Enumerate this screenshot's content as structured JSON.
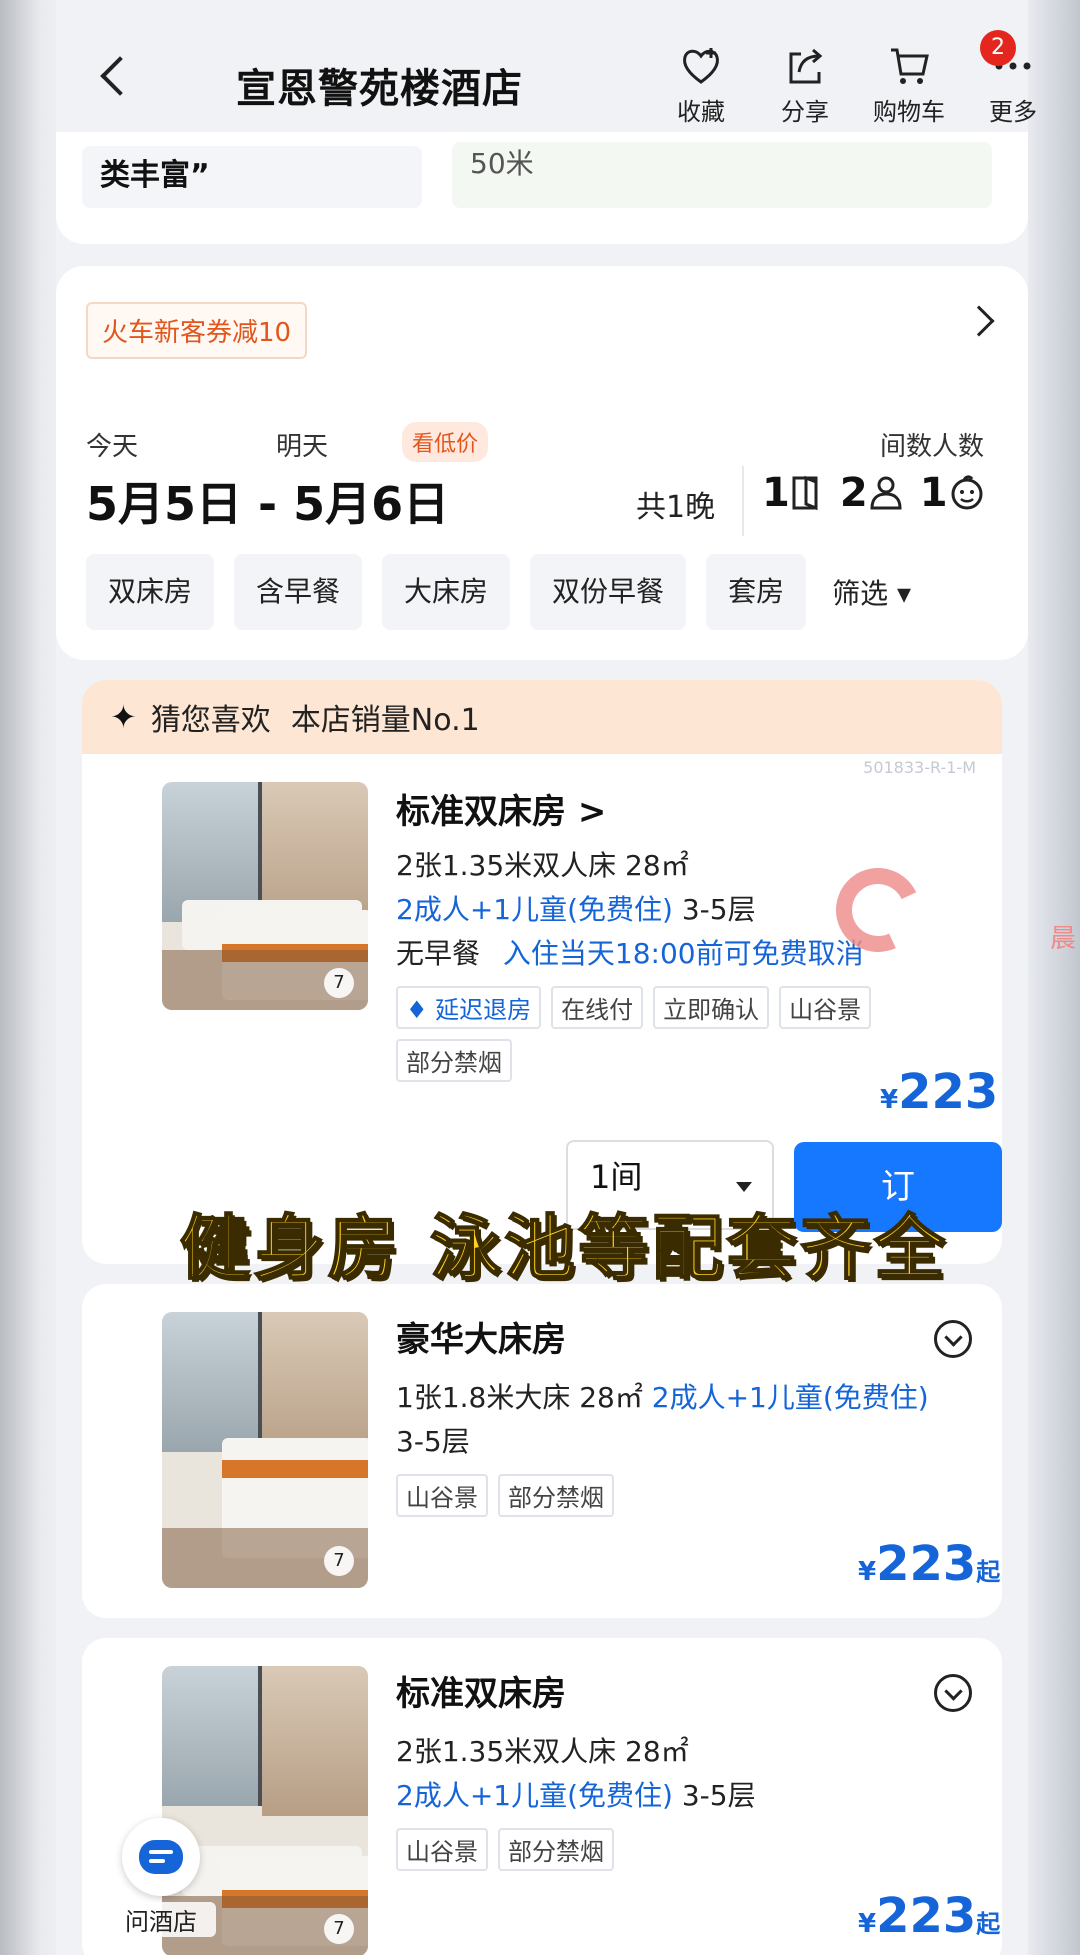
{
  "header": {
    "title": "宣恩警苑楼酒店",
    "actions": [
      {
        "label": "收藏",
        "icon": "heart-plus-icon"
      },
      {
        "label": "分享",
        "icon": "share-icon"
      },
      {
        "label": "购物车",
        "icon": "cart-icon"
      },
      {
        "label": "更多",
        "icon": "more-icon"
      }
    ],
    "more_badge": "2"
  },
  "top_fragment": {
    "left": "类丰富”",
    "right": "50米"
  },
  "coupon": "火车新客券减10",
  "booking": {
    "checkin_label": "今天",
    "checkout_label": "明天",
    "low_price": "看低价",
    "dates": "5月5日 - 5月6日",
    "nights": "共1晚",
    "guest_label": "间数人数",
    "rooms": "1",
    "adults": "2",
    "children": "1"
  },
  "filters": [
    "双床房",
    "含早餐",
    "大床房",
    "双份早餐",
    "套房"
  ],
  "filter_button": "筛选",
  "recommend": {
    "label": "猜您喜欢",
    "sub": "本店销量No.1",
    "code": "501833-R-1-M"
  },
  "rooms": [
    {
      "name": "标准双床房 >",
      "line1": "2张1.35米双人床  28㎡",
      "occupancy": "2成人+1儿童(免费住)",
      "floors": "3-5层",
      "breakfast": "无早餐",
      "cancel": "入住当天18:00前可免费取消",
      "tags": [
        "延迟退房",
        "在线付",
        "立即确认",
        "山谷景",
        "部分禁烟"
      ],
      "photo_count": "7",
      "price_symbol": "¥",
      "price": "223",
      "quantity": "1间",
      "book": "订"
    },
    {
      "name": "豪华大床房",
      "line1": "1张1.8米大床  28㎡",
      "occupancy": "2成人+1儿童(免费住)",
      "floors": "3-5层",
      "tags": [
        "山谷景",
        "部分禁烟"
      ],
      "photo_count": "7",
      "price_symbol": "¥",
      "price": "223",
      "price_suffix": "起"
    },
    {
      "name": "标准双床房",
      "line1": "2张1.35米双人床  28㎡",
      "occupancy": "2成人+1儿童(免费住)",
      "floors": "3-5层",
      "tags": [
        "山谷景",
        "部分禁烟"
      ],
      "photo_count": "7",
      "price_symbol": "¥",
      "price": "223",
      "price_suffix": "起"
    }
  ],
  "overlay_caption": "健身房 泳池等配套齐全",
  "side_char": "晨",
  "ask_hotel": "问酒店",
  "colors": {
    "accent_blue": "#1677ff",
    "coupon_orange": "#e2561b",
    "caption_yellow": "#ffd21e"
  }
}
